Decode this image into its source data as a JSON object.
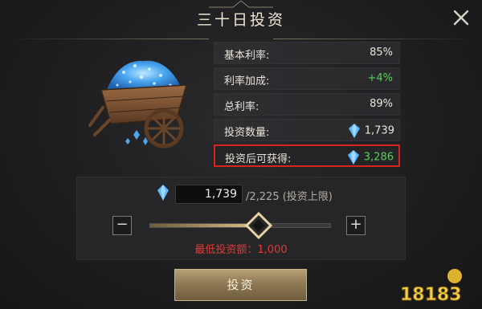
{
  "dialog": {
    "title": "三十日投资",
    "close_icon": "close-icon"
  },
  "stats": [
    {
      "label": "基本利率:",
      "value": "85%",
      "value_color": "#e9e4da"
    },
    {
      "label": "利率加成:",
      "value": "+4%",
      "value_color": "#55d15a"
    },
    {
      "label": "总利率:",
      "value": "89%",
      "value_color": "#e9e4da"
    },
    {
      "label": "投资数量:",
      "value": "1,739",
      "value_color": "#e9e4da",
      "icon": "diamond-icon"
    },
    {
      "label": "投资后可获得:",
      "value": "3,286",
      "value_color": "#55d15a",
      "icon": "diamond-icon",
      "highlighted": true
    }
  ],
  "investment": {
    "amount": "1,739",
    "limit_text": "/2,225 (投资上限)",
    "slider_level": 0.6,
    "min_text": "最低投资额：1,000",
    "minus_label": "−",
    "plus_label": "+"
  },
  "action": {
    "invest_label": "投资"
  },
  "watermark": {
    "text": "18183"
  },
  "colors": {
    "accent_gold": "#c9b38a",
    "highlight_red": "#d9231f",
    "positive_green": "#55d15a",
    "warning_red": "#e03b36",
    "gem_blue": "#5ab8ff"
  }
}
